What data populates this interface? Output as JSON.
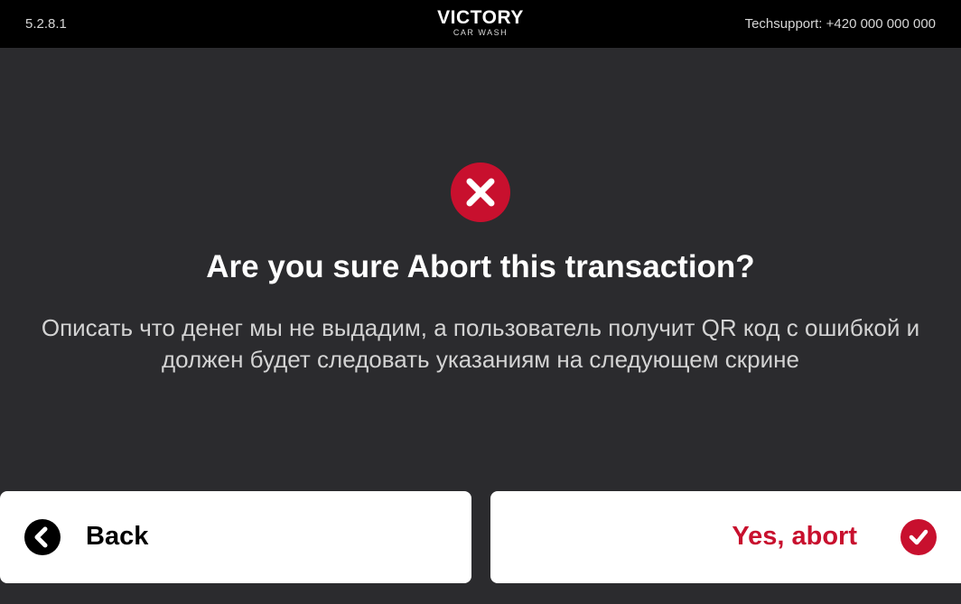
{
  "header": {
    "version": "5.2.8.1",
    "brand": "VICTORY",
    "brand_sub": "CAR WASH",
    "support": "Techsupport: +420 000 000 000"
  },
  "dialog": {
    "icon": "close-circle-icon",
    "title": "Are you sure Abort this transaction?",
    "description": "Описать что денег мы не выдадим, а пользователь получит QR код с ошибкой и должен будет следовать указаниям на следующем скрине"
  },
  "buttons": {
    "back": {
      "label": "Back",
      "icon": "chevron-left-icon"
    },
    "abort": {
      "label": "Yes, abort",
      "icon": "check-icon"
    }
  },
  "colors": {
    "accent": "#c8102e",
    "background": "#2b2b2e",
    "topbar": "#000000"
  }
}
